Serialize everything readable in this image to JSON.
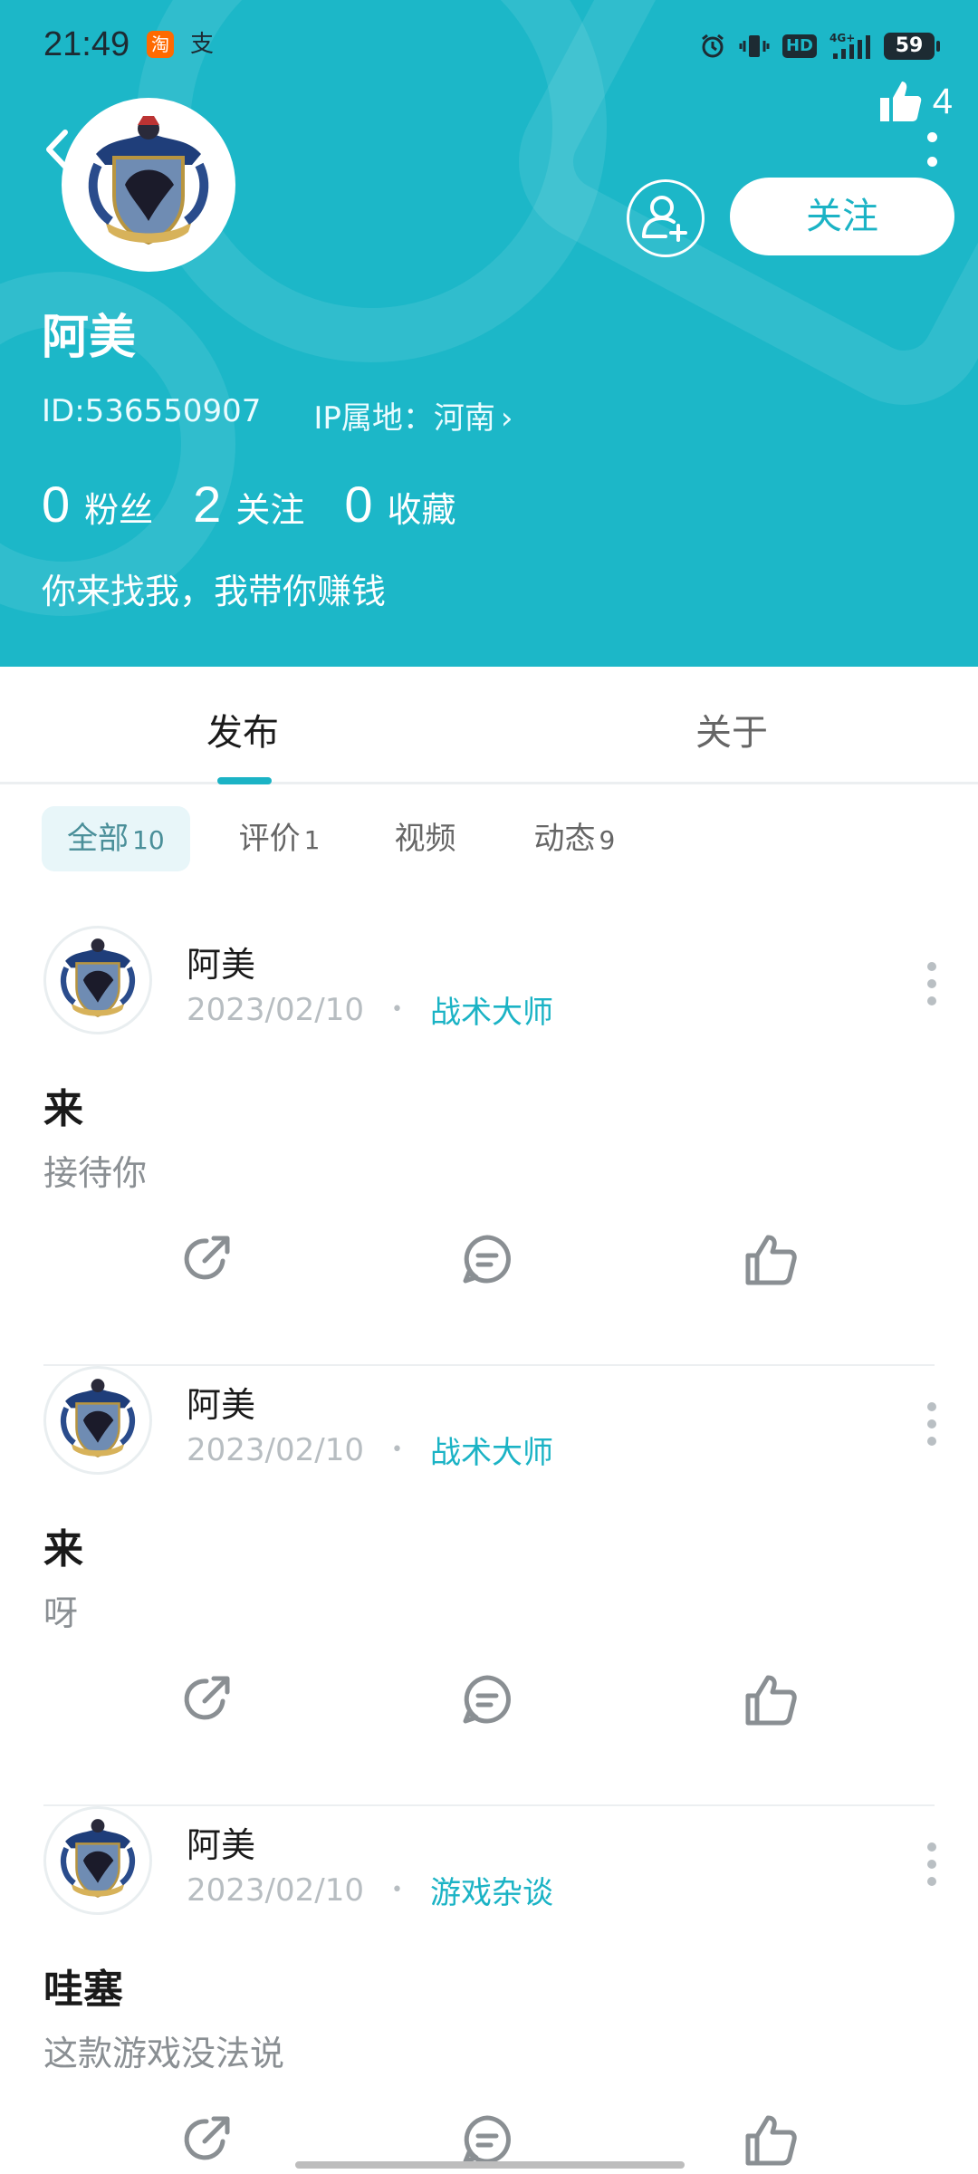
{
  "status_bar": {
    "time": "21:49",
    "app_icon_1": "淘",
    "app_icon_2": "支",
    "network": "4G",
    "hd": "HD",
    "battery": "59"
  },
  "header": {
    "like_count": "4",
    "follow_label": "关注",
    "username": "阿美",
    "user_id": "ID:536550907",
    "ip_location": "IP属地：河南",
    "stats": [
      {
        "value": "0",
        "label": "粉丝"
      },
      {
        "value": "2",
        "label": "关注"
      },
      {
        "value": "0",
        "label": "收藏"
      }
    ],
    "bio": "你来找我，我带你赚钱"
  },
  "tabs": {
    "post": "发布",
    "about": "关于"
  },
  "chips": [
    {
      "label": "全部",
      "count": "10"
    },
    {
      "label": "评价",
      "count": "1"
    },
    {
      "label": "视频",
      "count": ""
    },
    {
      "label": "动态",
      "count": "9"
    }
  ],
  "posts": [
    {
      "author": "阿美",
      "date": "2023/02/10",
      "category": "战术大师",
      "title": "来",
      "body": "接待你"
    },
    {
      "author": "阿美",
      "date": "2023/02/10",
      "category": "战术大师",
      "title": "来",
      "body": "呀"
    },
    {
      "author": "阿美",
      "date": "2023/02/10",
      "category": "游戏杂谈",
      "title": "哇塞",
      "body": "这款游戏没法说"
    }
  ],
  "colors": {
    "accent": "#1bb3c5",
    "header_bg": "#1cb7c8"
  }
}
